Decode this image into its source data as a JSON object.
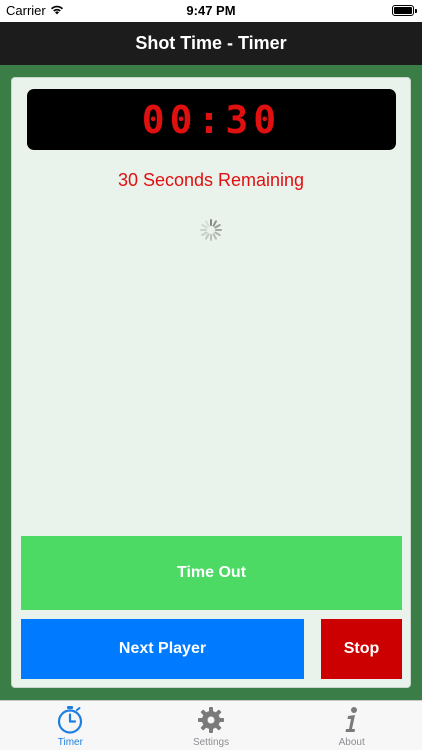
{
  "status_bar": {
    "carrier": "Carrier",
    "time": "9:47 PM",
    "wifi_icon": "wifi-icon",
    "battery_icon": "battery-icon"
  },
  "nav": {
    "title": "Shot Time - Timer"
  },
  "timer": {
    "display": "00:30",
    "remaining_text": "30 Seconds Remaining",
    "spinner_icon": "activity-spinner-icon"
  },
  "buttons": {
    "time_out": "Time Out",
    "next_player": "Next Player",
    "stop": "Stop"
  },
  "tabs": [
    {
      "label": "Timer",
      "icon": "stopwatch-icon",
      "active": true
    },
    {
      "label": "Settings",
      "icon": "gear-icon",
      "active": false
    },
    {
      "label": "About",
      "icon": "info-icon",
      "active": false
    }
  ],
  "colors": {
    "background_green": "#3a7d47",
    "timer_red": "#e01010",
    "time_out_green": "#4cd964",
    "next_player_blue": "#007aff",
    "stop_red": "#cc0000",
    "tab_active_blue": "#1d7fe0"
  }
}
